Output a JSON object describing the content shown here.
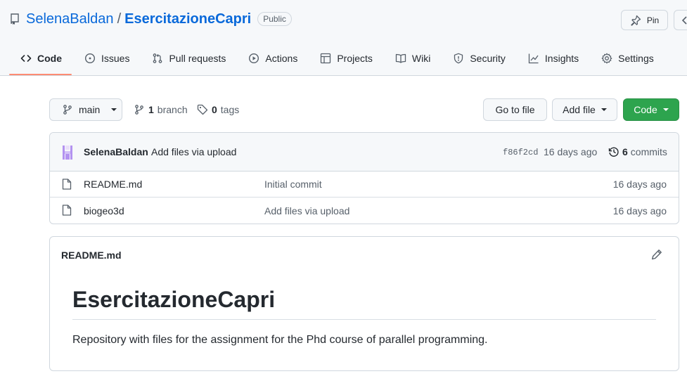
{
  "repo": {
    "owner": "SelenaBaldan",
    "separator": "/",
    "name": "EsercitazioneCapri",
    "visibility": "Public"
  },
  "actions": {
    "pin_label": "Pin"
  },
  "tabs": [
    {
      "label": "Code",
      "icon": "code-icon",
      "active": true
    },
    {
      "label": "Issues",
      "icon": "issue-icon"
    },
    {
      "label": "Pull requests",
      "icon": "pull-request-icon"
    },
    {
      "label": "Actions",
      "icon": "play-icon"
    },
    {
      "label": "Projects",
      "icon": "table-icon"
    },
    {
      "label": "Wiki",
      "icon": "book-icon"
    },
    {
      "label": "Security",
      "icon": "shield-icon"
    },
    {
      "label": "Insights",
      "icon": "graph-icon"
    },
    {
      "label": "Settings",
      "icon": "gear-icon"
    }
  ],
  "toolbar": {
    "branch": "main",
    "branch_count": "1",
    "branch_label": "branch",
    "tag_count": "0",
    "tag_label": "tags",
    "go_to_file": "Go to file",
    "add_file": "Add file",
    "code": "Code"
  },
  "latest_commit": {
    "author": "SelenaBaldan",
    "message": "Add files via upload",
    "sha": "f86f2cd",
    "age": "16 days ago",
    "commit_count": "6",
    "commit_label": "commits"
  },
  "files": [
    {
      "name": "README.md",
      "commit": "Initial commit",
      "age": "16 days ago",
      "icon": "file-icon"
    },
    {
      "name": "biogeo3d",
      "commit": "Add files via upload",
      "age": "16 days ago",
      "icon": "file-icon"
    }
  ],
  "readme": {
    "filename": "README.md",
    "title": "EsercitazioneCapri",
    "body": "Repository with files for the assignment for the Phd course of parallel programming."
  },
  "colors": {
    "link": "#0969da",
    "accent_underline": "#fd8c73",
    "primary_button": "#2da44e",
    "avatar": "#b392f0"
  }
}
